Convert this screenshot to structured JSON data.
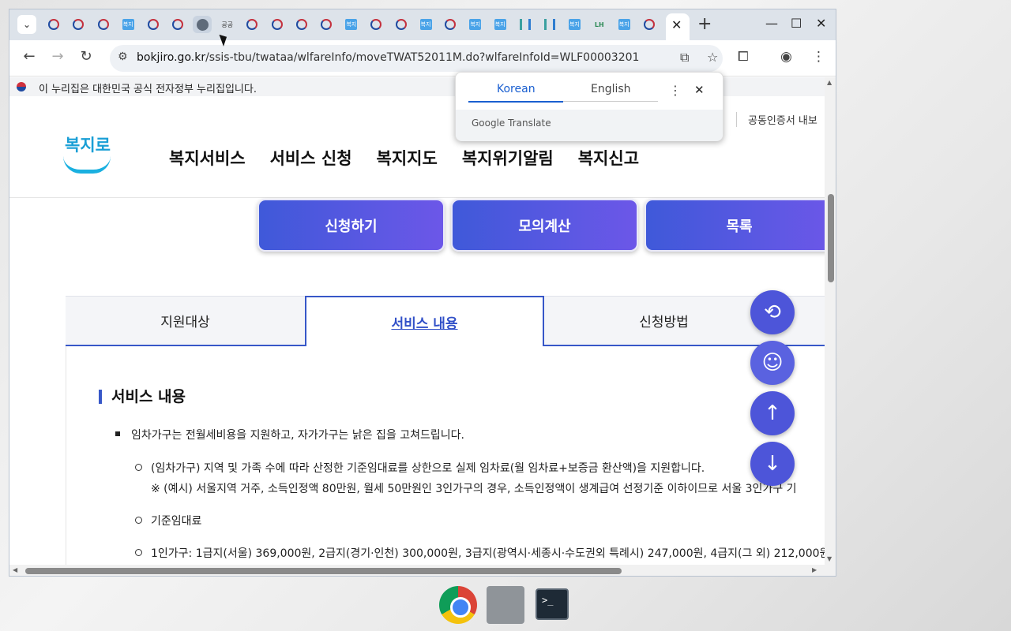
{
  "browser": {
    "tab_icons": [
      "gov",
      "gov",
      "gov",
      "bok",
      "gov",
      "gov",
      "globe",
      "gg",
      "gov",
      "gov",
      "gov",
      "gov",
      "bok",
      "gov",
      "gov",
      "bok",
      "gov",
      "bok",
      "bok",
      "bar",
      "bar",
      "bok",
      "lh",
      "bok",
      "gov"
    ],
    "gg_label": "공공",
    "lh_label": "LH",
    "bok_label": "복지",
    "url_host": "bokjiro.go.kr",
    "url_path": "/ssis-tbu/twataa/wlfareInfo/moveTWAT52011M.do?wlfareInfoId=WLF00003201",
    "close_tab_label": "✕",
    "new_tab_label": "+"
  },
  "govbar": {
    "text": "이 누리집은 대한민국 공식 전자정부 누리집입니다."
  },
  "header": {
    "logo_text": "복지로",
    "cert_link": "공동인증서 내보",
    "nav": [
      "복지서비스",
      "서비스 신청",
      "복지지도",
      "복지위기알림",
      "복지신고"
    ]
  },
  "actions": {
    "apply": "신청하기",
    "simulate": "모의계산",
    "list": "목록"
  },
  "tabs": {
    "items": [
      "지원대상",
      "서비스 내용",
      "신청방법"
    ],
    "active": "서비스 내용"
  },
  "content": {
    "section_title": "서비스 내용",
    "bullet1": "임차가구는 전월세비용을 지원하고, 자가가구는 낡은 집을 고쳐드립니다.",
    "sub1": "(임차가구) 지역 및 가족 수에 따라 산정한 기준임대료를 상한으로 실제 임차료(월 임차료+보증금 환산액)을 지원합니다.",
    "sub1_note": "※ (예시) 서울지역 거주, 소득인정액 80만원, 월세 50만원인 3인가구의 경우, 소득인정액이 생계급여 선정기준 이하이므로 서울 3인가구 기",
    "sub2": "기준임대료",
    "sub3": "1인가구: 1급지(서울) 369,000원, 2급지(경기·인천) 300,000원, 3급지(광역시·세종시·수도권외 특례시) 247,000원, 4급지(그 외) 212,000원"
  },
  "translate_popup": {
    "tab_source": "Korean",
    "tab_target": "English",
    "brand": "Google Translate"
  },
  "taskbar": {
    "terminal_label": ">_"
  }
}
